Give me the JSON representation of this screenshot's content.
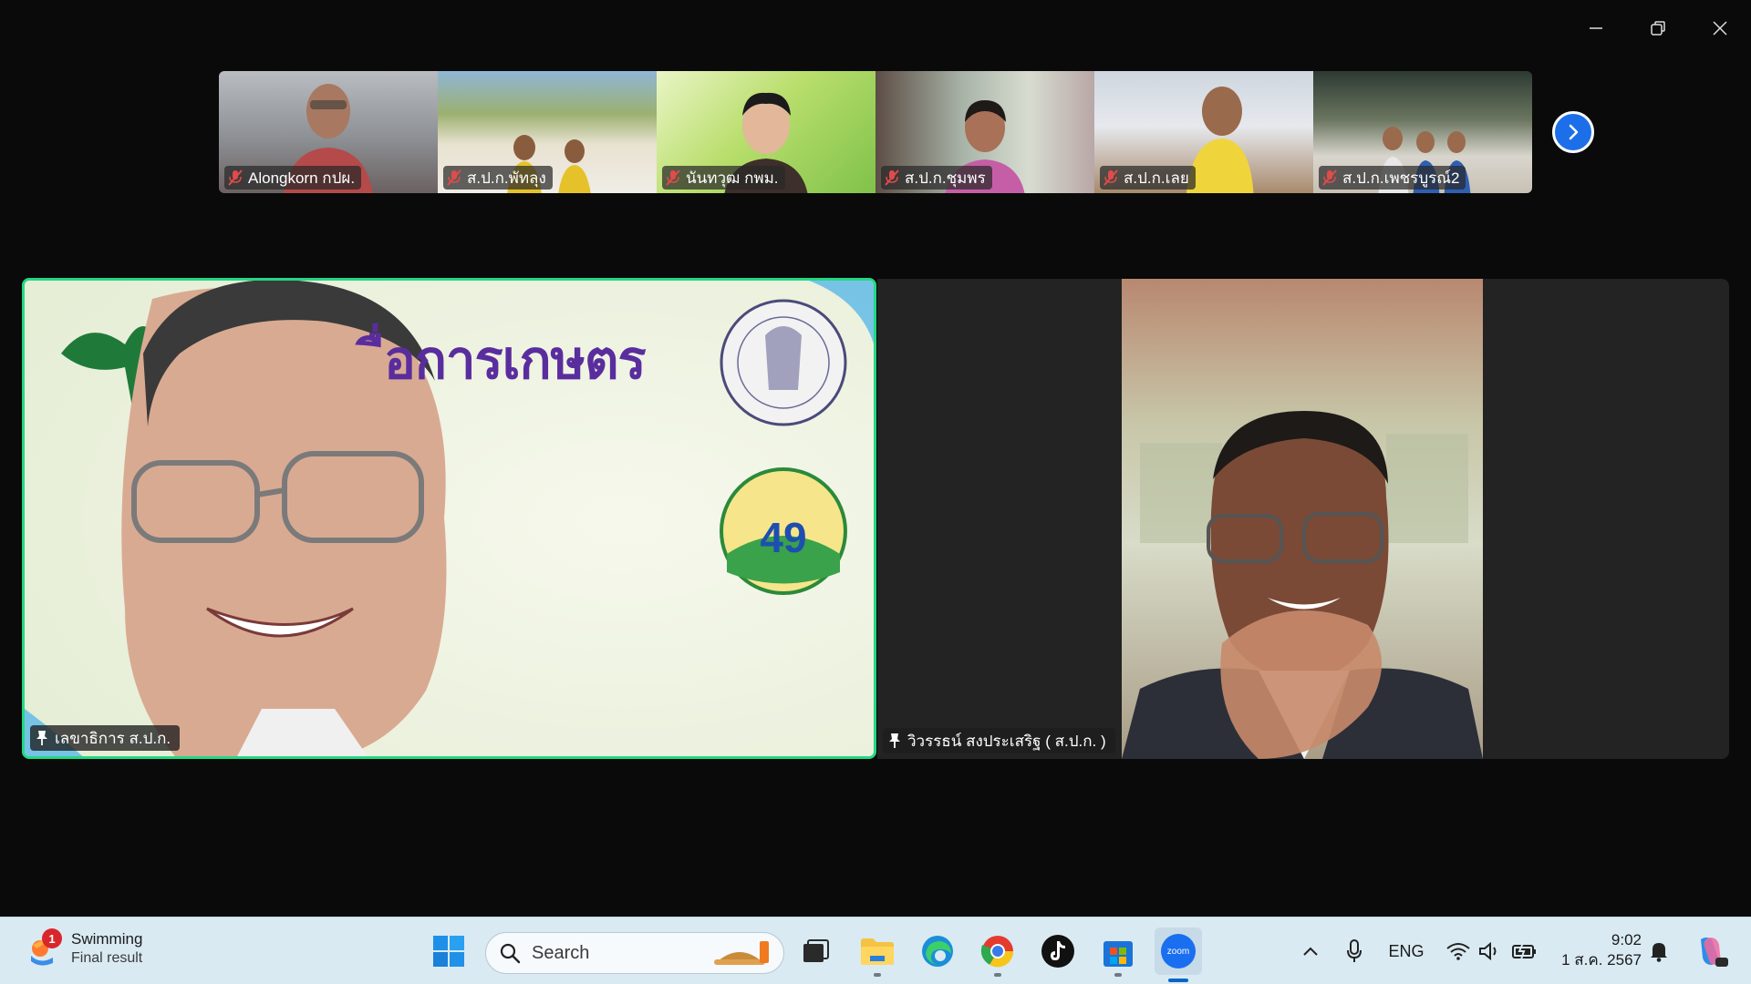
{
  "window": {
    "controls": [
      "minimize",
      "restore",
      "close"
    ]
  },
  "thumbnails": [
    {
      "name": "Alongkorn กปผ."
    },
    {
      "name": "ส.ป.ก.พัทลุง"
    },
    {
      "name": "นันทวุฒ กพม."
    },
    {
      "name": "ส.ป.ก.ชุมพร"
    },
    {
      "name": "ส.ป.ก.เลย"
    },
    {
      "name": "ส.ป.ก.เพชรบูรณ์2"
    }
  ],
  "main": {
    "left": {
      "name": "เลขาธิการ ส.ป.ก.",
      "banner_text": "ื่อการเกษตร",
      "logo_number": "49"
    },
    "right": {
      "name": "วิวรรธน์ สงประเสริฐ ( ส.ป.ก. )"
    }
  },
  "taskbar": {
    "weather": {
      "badge": "1",
      "title": "Swimming",
      "subtitle": "Final result"
    },
    "search_placeholder": "Search",
    "language": "ENG",
    "time": "9:02",
    "date": "1 ส.ค. 2567",
    "zoom_label": "zoom"
  },
  "colors": {
    "active_speaker_border": "#23d884",
    "accent": "#1c6fe8",
    "taskbar_bg": "#d9eaf2"
  }
}
